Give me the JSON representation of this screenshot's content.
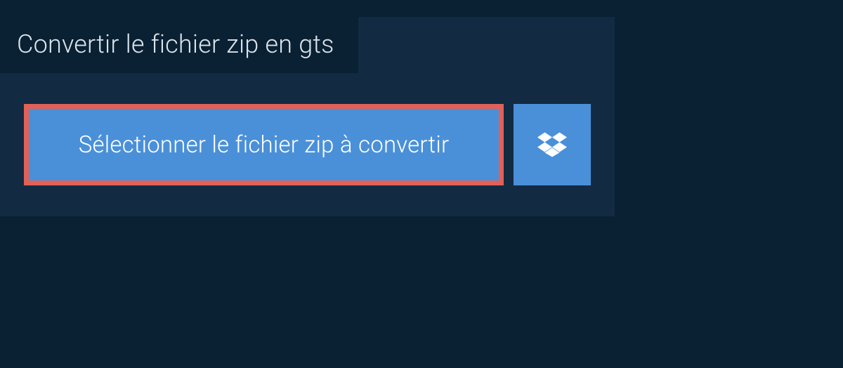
{
  "header": {
    "title": "Convertir le fichier zip en gts"
  },
  "upload": {
    "select_button_label": "Sélectionner le fichier zip à convertir",
    "dropbox_icon_name": "dropbox-icon"
  }
}
